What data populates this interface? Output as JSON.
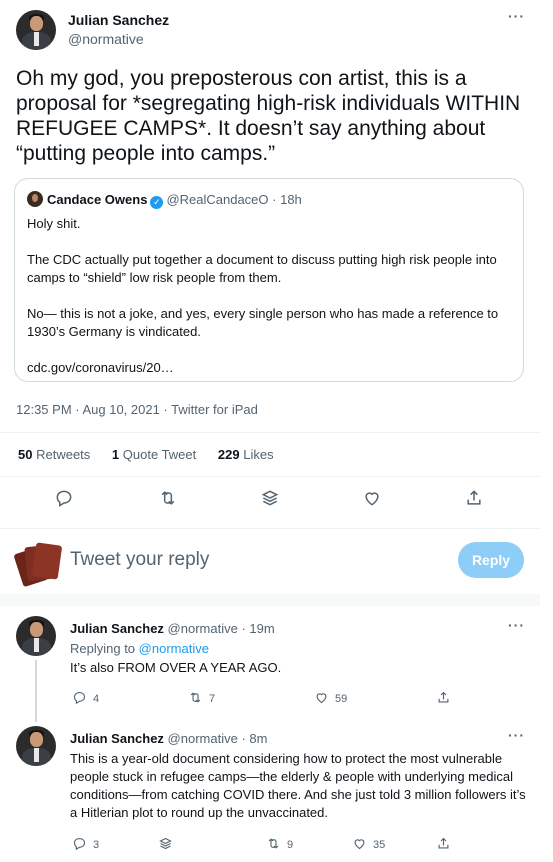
{
  "main_tweet": {
    "author_name": "Julian Sanchez",
    "author_handle": "@normative",
    "text": "Oh my god, you preposterous con artist, this is a proposal for *segregating high-risk individuals WITHIN REFUGEE CAMPS*.  It doesn’t say anything about “putting people into camps.”",
    "more_icon": "···",
    "meta": "12:35 PM · Aug 10, 2021 · Twitter for iPad"
  },
  "quoted_tweet": {
    "author_name": "Candace Owens",
    "author_handle": "@RealCandaceO",
    "time": "· 18h",
    "paragraphs": [
      "Holy shit.",
      "The CDC actually put together a document to discuss putting high risk people into camps to “shield” low risk people from them.",
      "No— this is not a joke, and yes, every single person who has made a reference to 1930’s Germany is vindicated.",
      "cdc.gov/coronavirus/20…"
    ]
  },
  "stats": {
    "retweets_count": "50",
    "retweets_label": "Retweets",
    "quotes_count": "1",
    "quotes_label": "Quote Tweet",
    "likes_count": "229",
    "likes_label": "Likes"
  },
  "reply_box": {
    "placeholder": "Tweet your reply",
    "button_label": "Reply"
  },
  "replies": [
    {
      "author_name": "Julian Sanchez",
      "author_handle": "@normative",
      "time": "· 19m",
      "replying_to_label": "Replying to",
      "replying_to_handle": "@normative",
      "text": "It’s also FROM OVER A YEAR AGO.",
      "reply_count": "4",
      "retweet_count": "7",
      "like_count": "59",
      "more_icon": "···"
    },
    {
      "author_name": "Julian Sanchez",
      "author_handle": "@normative",
      "time": "· 8m",
      "text": "This is a year-old document considering how to protect the most vulnerable people stuck in refugee camps—the elderly & people with underlying medical conditions—from catching COVID there.  And she just told 3 million followers it’s a Hitlerian plot to round up the unvaccinated.",
      "reply_count": "3",
      "retweet_count": "9",
      "like_count": "35",
      "more_icon": "···"
    }
  ],
  "colors": {
    "accent": "#1d9bf0",
    "reply_button_disabled": "#8ecdf8",
    "secondary_text": "#536471",
    "border": "#cfd9de"
  },
  "icons": [
    "reply-icon",
    "retweet-icon",
    "layers-icon",
    "heart-icon",
    "share-icon",
    "more-icon",
    "verified-icon"
  ]
}
